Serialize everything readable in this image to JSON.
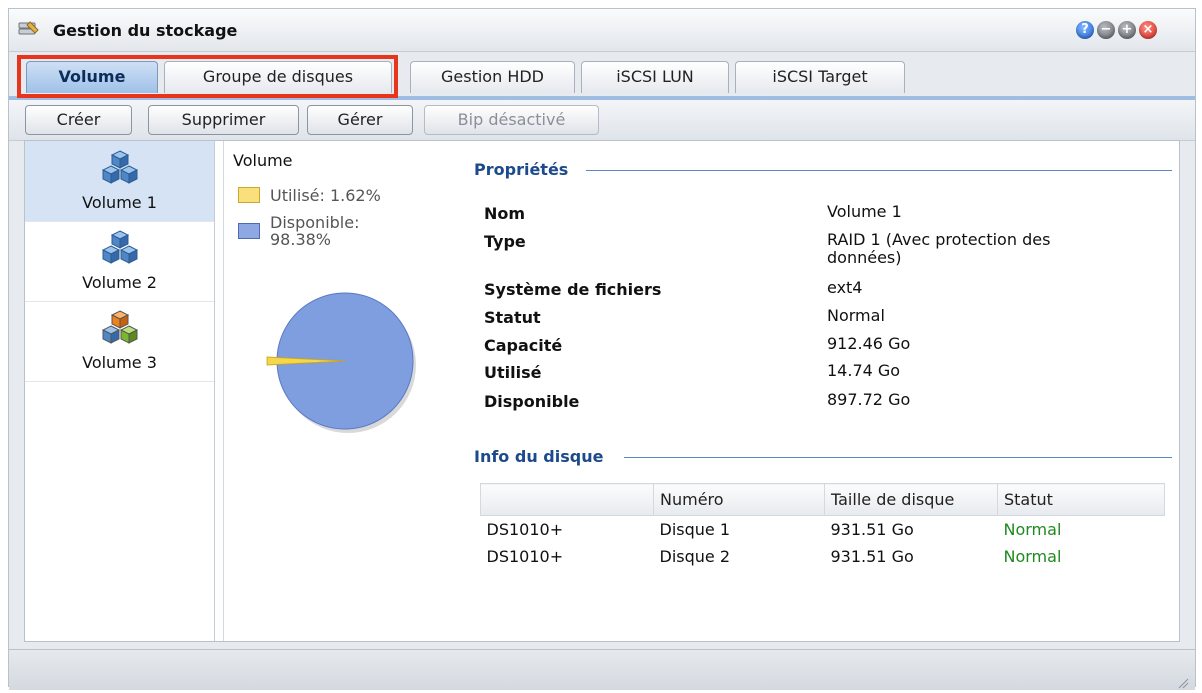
{
  "window": {
    "title": "Gestion du stockage",
    "icons": [
      "storage-manager-icon",
      "help-icon",
      "minimize-icon",
      "maximize-icon",
      "close-icon"
    ]
  },
  "tabs": [
    {
      "label": "Volume",
      "active": true
    },
    {
      "label": "Groupe de disques",
      "active": false
    },
    {
      "label": "Gestion HDD",
      "active": false
    },
    {
      "label": "iSCSI LUN",
      "active": false
    },
    {
      "label": "iSCSI Target",
      "active": false
    }
  ],
  "toolbar": {
    "create": "Créer",
    "delete": "Supprimer",
    "manage": "Gérer",
    "beep": "Bip désactivé"
  },
  "volumes": [
    {
      "label": "Volume 1",
      "selected": true,
      "icon": "volume-cubes-blue-icon"
    },
    {
      "label": "Volume 2",
      "selected": false,
      "icon": "volume-cubes-blue-icon"
    },
    {
      "label": "Volume 3",
      "selected": false,
      "icon": "volume-cubes-colored-icon"
    }
  ],
  "usage": {
    "title": "Volume",
    "used_label": "Utilisé: 1.62%",
    "free_label_line1": "Disponible:",
    "free_label_line2": "98.38%",
    "used_color": "#f5d84a",
    "free_color": "#7f9ee0"
  },
  "chart_data": {
    "type": "pie",
    "title": "Volume",
    "series": [
      {
        "name": "Utilisé",
        "value": 1.62
      },
      {
        "name": "Disponible",
        "value": 98.38
      }
    ],
    "legend": "top-left"
  },
  "properties": {
    "title": "Propriétés",
    "rows": [
      {
        "label": "Nom",
        "value": "Volume 1"
      },
      {
        "label": "Type",
        "value": "RAID 1 (Avec protection des",
        "value2": "données)"
      },
      {
        "label": "Système de fichiers",
        "value": "ext4"
      },
      {
        "label": "Statut",
        "value": "Normal"
      },
      {
        "label": "Capacité",
        "value": "912.46 Go"
      },
      {
        "label": "Utilisé",
        "value": "14.74 Go"
      },
      {
        "label": "Disponible",
        "value": "897.72 Go"
      }
    ]
  },
  "disks": {
    "title": "Info du disque",
    "headers": [
      "",
      "Numéro",
      "Taille de disque",
      "Statut"
    ],
    "rows": [
      {
        "unit": "DS1010+",
        "number": "Disque 1",
        "size": "931.51 Go",
        "status": "Normal"
      },
      {
        "unit": "DS1010+",
        "number": "Disque 2",
        "size": "931.51 Go",
        "status": "Normal"
      }
    ],
    "status_color": "#1f8a1f"
  }
}
